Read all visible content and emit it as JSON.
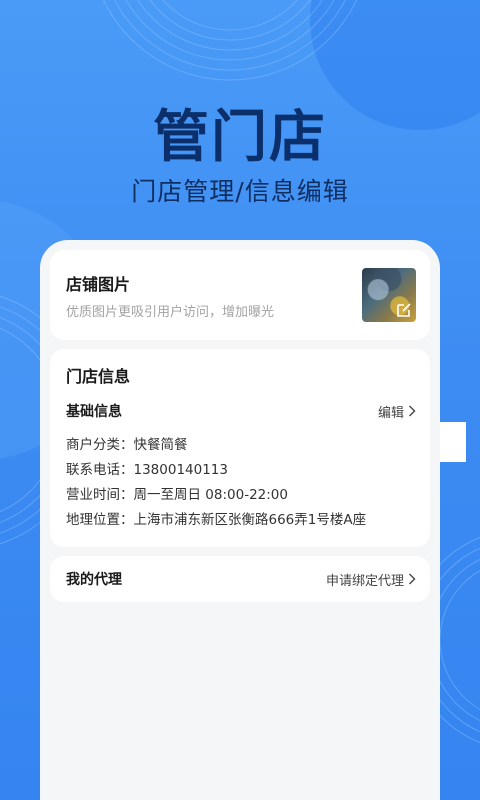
{
  "hero": {
    "title": "管门店",
    "subtitle": "门店管理/信息编辑"
  },
  "photo_card": {
    "title": "店铺图片",
    "desc": "优质图片更吸引用户访问，增加曝光",
    "thumb_icon": "edit-square-icon"
  },
  "info_card": {
    "title": "门店信息",
    "section": "基础信息",
    "edit_label": "编辑",
    "lines": [
      {
        "k": "商户分类：",
        "v": "快餐简餐"
      },
      {
        "k": "联系电话：",
        "v": "13800140113"
      },
      {
        "k": "营业时间：",
        "v": "周一至周日 08:00-22:00"
      },
      {
        "k": "地理位置：",
        "v": "上海市浦东新区张衡路666弄1号楼A座"
      }
    ]
  },
  "agent_card": {
    "title": "我的代理",
    "action_label": "申请绑定代理"
  },
  "colors": {
    "bg": "#3d8cf3",
    "hero_text": "#0a2f6b",
    "panel": "#f5f6f8"
  }
}
